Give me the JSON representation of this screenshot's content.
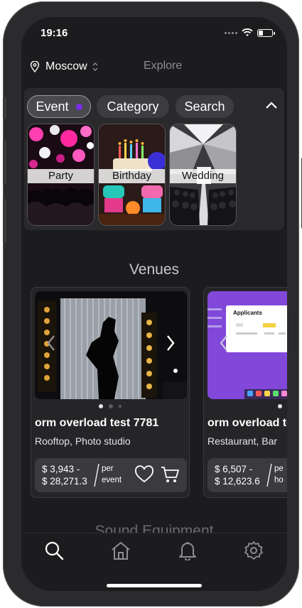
{
  "status_bar": {
    "time": "19:16"
  },
  "header": {
    "city": "Moscow",
    "explore_label": "Explore"
  },
  "filters": {
    "chips": [
      {
        "label": "Event",
        "active": true
      },
      {
        "label": "Category",
        "active": false
      },
      {
        "label": "Search",
        "active": false
      }
    ],
    "event_types": [
      {
        "label": "Party"
      },
      {
        "label": "Birthday"
      },
      {
        "label": "Wedding"
      }
    ]
  },
  "venues": {
    "section_title": "Venues",
    "cards": [
      {
        "title": "orm overload test 7781",
        "subtitle": "Rooftop, Photo studio",
        "price_min": "$ 3,943 -",
        "price_max": "$ 28,271.3",
        "per_line1": "per",
        "per_line2": "event",
        "pager": {
          "count": 3,
          "current": 1
        }
      },
      {
        "title": "orm overload test",
        "subtitle": "Restaurant, Bar",
        "price_min": "$ 6,507 -",
        "price_max": "$ 12,623.6",
        "per_line1": "pe",
        "per_line2": "ho",
        "thumb_heading": "Applicants"
      }
    ]
  },
  "next_section_title": "Sound Equipment",
  "tabbar": {
    "items": [
      {
        "icon": "search-icon",
        "active": true
      },
      {
        "icon": "home-icon",
        "active": false
      },
      {
        "icon": "bell-icon",
        "active": false
      },
      {
        "icon": "gear-icon",
        "active": false
      }
    ]
  },
  "colors": {
    "accent": "#7c2cf0",
    "background": "#1c1b1d",
    "panel": "#2a292c"
  }
}
